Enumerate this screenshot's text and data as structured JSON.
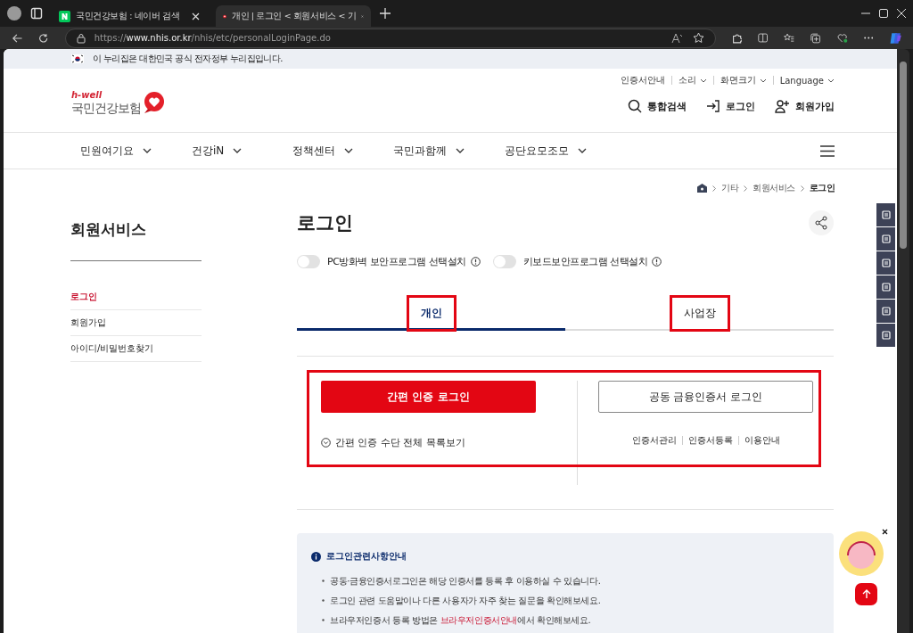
{
  "browser": {
    "tabs": [
      {
        "title": "국민건강보험 : 네이버 검색",
        "selected": false,
        "kind": "naver"
      },
      {
        "title": "개인 | 로그인 < 회원서비스 < 기",
        "selected": true,
        "kind": "nhis"
      }
    ],
    "url": "https://**www.nhis.or.kr**/nhis/etc/personalLoginPage.do"
  },
  "gov_banner": "이 누리집은 대한민국 공식 전자정부 누리집입니다.",
  "utility_links": [
    {
      "label": "인증서안내",
      "has_menu": false
    },
    {
      "label": "소리",
      "has_menu": true
    },
    {
      "label": "화면크기",
      "has_menu": true
    },
    {
      "label": "Language",
      "has_menu": true
    }
  ],
  "logo": {
    "tagline": "h-well",
    "name": "국민건강보험"
  },
  "header_actions": [
    {
      "label": "통합검색",
      "kind": "search"
    },
    {
      "label": "로그인",
      "kind": "login"
    },
    {
      "label": "회원가입",
      "kind": "join"
    }
  ],
  "nav": [
    "민원여기요",
    "건강iN",
    "정책센터",
    "국민과함께",
    "공단요모조모"
  ],
  "breadcrumb": [
    "기타",
    "회원서비스",
    "로그인"
  ],
  "sidebar": {
    "title": "회원서비스",
    "items": [
      {
        "label": "로그인",
        "selected": true
      },
      {
        "label": "회원가입",
        "selected": false
      },
      {
        "label": "아이디/비밀번호찾기",
        "selected": false
      }
    ]
  },
  "page_title": "로그인",
  "toggles": [
    {
      "label": "PC방화벽 보안프로그램 선택설치",
      "on": false
    },
    {
      "label": "키보드보안프로그램 선택설치",
      "on": false
    }
  ],
  "login_tabs": [
    {
      "label": "개인",
      "selected": true,
      "highlighted": true
    },
    {
      "label": "사업장",
      "selected": false,
      "highlighted": true
    }
  ],
  "login_area_highlighted": true,
  "simple_login": {
    "button": "간편 인증 로그인",
    "list_link": "간편 인증 수단 전체 목록보기"
  },
  "certificate_login": {
    "button": "공동 금융인증서 로그인",
    "links": [
      "인증서관리",
      "인증서등록",
      "이용안내"
    ]
  },
  "notice": {
    "title": "로그인관련사항안내",
    "items": [
      {
        "text": "공동·금융인증서로그인은 해당 인증서를 등록 후 이용하실 수 있습니다."
      },
      {
        "text": "로그인 관련 도움말이나 다른 사용자가 자주 찾는 질문을 확인해보세요."
      },
      {
        "text": "브라우저인증서 등록 방법은 ",
        "link": "브라우저인증서안내",
        "text_after": "에서 확인해보세요."
      }
    ]
  }
}
